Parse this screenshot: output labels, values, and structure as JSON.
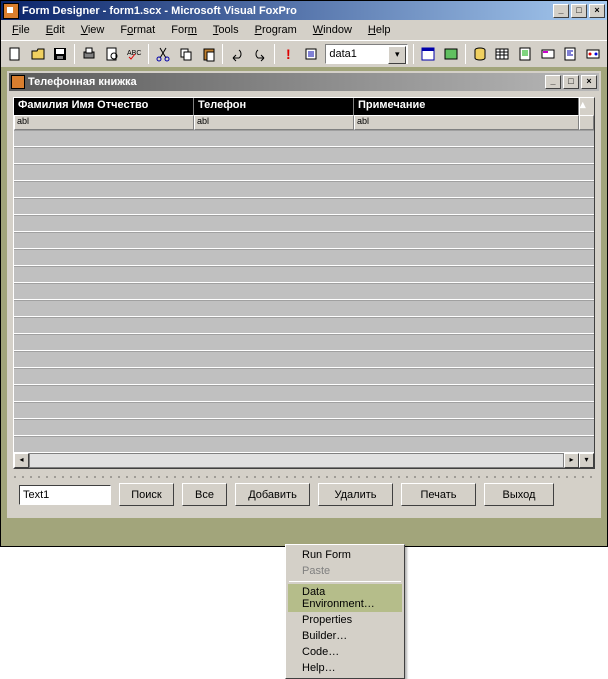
{
  "window": {
    "title": "Form Designer - form1.scx - Microsoft Visual FoxPro",
    "min": "_",
    "max": "□",
    "close": "×"
  },
  "menu": {
    "file": "File",
    "edit": "Edit",
    "view": "View",
    "format": "Format",
    "form": "Form",
    "tools": "Tools",
    "program": "Program",
    "window": "Window",
    "help": "Help"
  },
  "toolbar": {
    "combo_value": "data1"
  },
  "form": {
    "title": "Телефонная книжка",
    "min": "_",
    "max": "□",
    "close": "×",
    "grid": {
      "col1": "Фамилия Имя Отчество",
      "col2": "Телефон",
      "col3": "Примечание",
      "abl": "abl"
    },
    "text1": "Text1",
    "btn_search": "Поиск",
    "btn_all": "Все",
    "btn_add": "Добавить",
    "btn_delete": "Удалить",
    "btn_print": "Печать",
    "btn_exit": "Выход"
  },
  "context": {
    "runform": "Run Form",
    "paste": "Paste",
    "dataenv": "Data Environment…",
    "properties": "Properties",
    "builder": "Builder…",
    "code": "Code…",
    "help": "Help…"
  }
}
